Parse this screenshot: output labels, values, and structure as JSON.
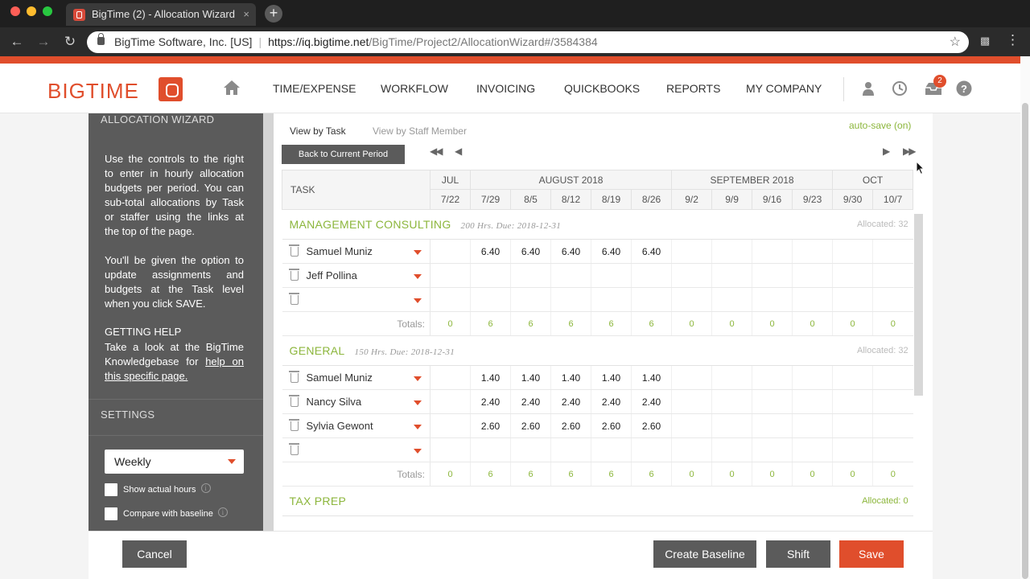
{
  "browser": {
    "tab_title": "BigTime (2) - Allocation Wizard",
    "tab_close": "×",
    "new_tab": "+",
    "site_identity": "BigTime Software, Inc. [US]",
    "url_scheme_host": "https://iq.bigtime.net",
    "url_path": "/BigTime/Project2/AllocationWizard#/3584384",
    "back": "←",
    "forward": "→",
    "reload": "↻",
    "star": "☆",
    "menu": "⋮"
  },
  "header": {
    "logo_text": "BIGTIME",
    "nav": [
      "TIME/EXPENSE",
      "WORKFLOW",
      "INVOICING",
      "QUICKBOOKS",
      "REPORTS",
      "MY COMPANY"
    ],
    "notification_count": "2"
  },
  "sidebar": {
    "title": "ALLOCATION WIZARD",
    "description": "Use the controls to the right to enter in hourly allocation budgets per period. You can sub-total allocations by Task or staffer using the links at the top of the page.",
    "description2": "You'll be given the option to update assignments and budgets at the Task level when you click SAVE.",
    "help_title": "GETTING HELP",
    "help_text": "Take a look at the BigTime Knowledgebase for ",
    "help_link": "help on this specific page.",
    "settings_title": "SETTINGS",
    "period_select": "Weekly",
    "show_actual_hours": "Show actual hours",
    "compare_baseline": "Compare with baseline"
  },
  "main": {
    "view_by_task": "View by Task",
    "view_by_staff": "View by Staff Member",
    "autosave": "auto-save (on)",
    "back_to_current": "Back to Current Period",
    "pager_first": "◀◀",
    "pager_prev": "◀",
    "pager_next": "▶",
    "pager_last": "▶▶"
  },
  "grid": {
    "task_header": "TASK",
    "months": [
      {
        "label": "JUL",
        "span": 1
      },
      {
        "label": "AUGUST 2018",
        "span": 5
      },
      {
        "label": "SEPTEMBER 2018",
        "span": 4
      },
      {
        "label": "OCT",
        "span": 2
      }
    ],
    "weeks": [
      "7/22",
      "7/29",
      "8/5",
      "8/12",
      "8/19",
      "8/26",
      "9/2",
      "9/9",
      "9/16",
      "9/23",
      "9/30",
      "10/7"
    ],
    "totals_label": "Totals:",
    "projects": [
      {
        "name": "MANAGEMENT CONSULTING",
        "meta": "200 Hrs. Due: 2018-12-31",
        "allocated": "Allocated: 32",
        "allocated_green": false,
        "rows": [
          {
            "staff": "Samuel Muniz",
            "values": [
              "",
              "6.40",
              "6.40",
              "6.40",
              "6.40",
              "6.40",
              "",
              "",
              "",
              "",
              "",
              ""
            ]
          },
          {
            "staff": "Jeff Pollina",
            "values": [
              "",
              "",
              "",
              "",
              "",
              "",
              "",
              "",
              "",
              "",
              "",
              ""
            ]
          },
          {
            "staff": "",
            "values": [
              "",
              "",
              "",
              "",
              "",
              "",
              "",
              "",
              "",
              "",
              "",
              ""
            ]
          }
        ],
        "totals": [
          "0",
          "6",
          "6",
          "6",
          "6",
          "6",
          "0",
          "0",
          "0",
          "0",
          "0",
          "0"
        ]
      },
      {
        "name": "GENERAL",
        "meta": "150 Hrs. Due: 2018-12-31",
        "allocated": "Allocated: 32",
        "allocated_green": false,
        "rows": [
          {
            "staff": "Samuel Muniz",
            "values": [
              "",
              "1.40",
              "1.40",
              "1.40",
              "1.40",
              "1.40",
              "",
              "",
              "",
              "",
              "",
              ""
            ]
          },
          {
            "staff": "Nancy Silva",
            "values": [
              "",
              "2.40",
              "2.40",
              "2.40",
              "2.40",
              "2.40",
              "",
              "",
              "",
              "",
              "",
              ""
            ]
          },
          {
            "staff": "Sylvia Gewont",
            "values": [
              "",
              "2.60",
              "2.60",
              "2.60",
              "2.60",
              "2.60",
              "",
              "",
              "",
              "",
              "",
              ""
            ]
          },
          {
            "staff": "",
            "values": [
              "",
              "",
              "",
              "",
              "",
              "",
              "",
              "",
              "",
              "",
              "",
              ""
            ]
          }
        ],
        "totals": [
          "0",
          "6",
          "6",
          "6",
          "6",
          "6",
          "0",
          "0",
          "0",
          "0",
          "0",
          "0"
        ]
      },
      {
        "name": "TAX PREP",
        "meta": "",
        "allocated": "Allocated: 0",
        "allocated_green": true,
        "rows": [],
        "totals": []
      }
    ]
  },
  "footer": {
    "cancel": "Cancel",
    "create_baseline": "Create Baseline",
    "shift": "Shift",
    "save": "Save"
  },
  "colors": {
    "brand_red": "#e04e2c",
    "accent_green": "#8cb63c",
    "panel_gray": "#5b5b5b"
  }
}
